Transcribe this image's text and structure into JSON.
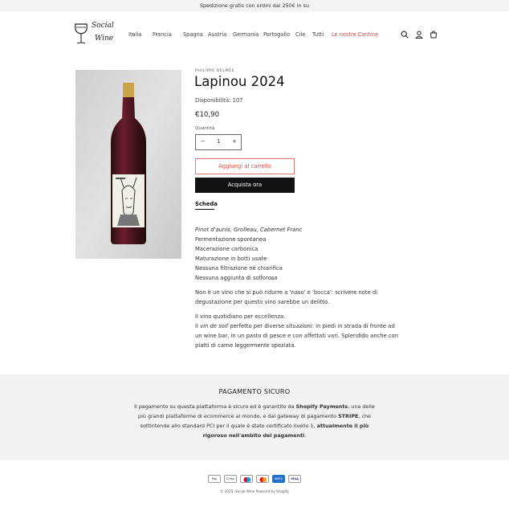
{
  "announcement": "Spedizione gratis con ordini dai 250€ in su",
  "logo": {
    "line1": "Social",
    "line2": "Wine"
  },
  "nav": {
    "items": [
      "Italia",
      "Francia",
      "Spagna",
      "Austria",
      "Germania",
      "Portogallo",
      "Cile",
      "Tutti",
      "Le nostre Cantine"
    ]
  },
  "header_icons": [
    "search-icon",
    "account-icon",
    "cart-icon"
  ],
  "product": {
    "vendor": "PHILIPPE DELMÉE",
    "title": "Lapinou 2024",
    "availability": "Disponibilità: 107",
    "price": "€10,90",
    "quantity_label": "Quantità",
    "quantity_value": "1",
    "minus": "−",
    "plus": "+",
    "add_to_cart": "Aggiungi al carrello",
    "buy_now": "Acquista ora",
    "tab": "Scheda"
  },
  "description": {
    "grapes": "Pinot d'aunis, Grolleau, Cabernet Franc",
    "lines": [
      "Fermentazione spontanea",
      "Macerazione carbonica",
      "Maturazione in botti usate",
      "Nessuna filtrazione né chiarifica",
      "Nessuna aggiunta di solforosa"
    ],
    "para1": [
      "Non è un vino che si può ridurre a 'naso' e 'bocca': scrivere note di",
      "degustazione per questo vino sarebbe un delitto."
    ],
    "para2_line1": "Il vino quotidiano per eccellenza.",
    "para2_line2_pre": "Il ",
    "para2_line2_em": "vin de soif",
    "para2_line2_post": " perfetto per diverse situazioni: in piedi in strada di fronte ad",
    "para2_rest": [
      "un wine bar, in un pasto di pesce e con affettati vari. Splendido anche con",
      "piatti di carne leggermente speziata."
    ]
  },
  "secure_payment": {
    "heading": "PAGAMENTO SICURO",
    "l1_a": "Il pagamento su questa piattaforma è sicuro ed è garantito da ",
    "l1_b": "Shopify Payments",
    "l1_c": ", una delle",
    "l2_a": "più grandi piattaforme di ecommerce al mondo, e dal gateway di pagamento ",
    "l2_b": "STRIPE",
    "l2_c": ", che",
    "l3_a": "sottintende allo standard PCI per il quale è stato certificato livello 1, ",
    "l3_b": "attualmente il più",
    "l4_a": "rigoroso nell'ambito dei pagamenti",
    "l4_b": "."
  },
  "payment_methods": [
    "Apple Pay",
    "G Pay",
    "Maestro",
    "Mastercard",
    "American Express",
    "Visa"
  ],
  "payment_labels": {
    "apple": "Pay",
    "gpay": "G Pay",
    "amex": "AMEX",
    "visa": "VISA"
  },
  "footer": {
    "copyright": "© 2025, Social Wine Powered by Shopify"
  },
  "colors": {
    "accent_red": "#e0443c",
    "dark_button": "#121212",
    "footer_bg": "#f2f2f2"
  }
}
